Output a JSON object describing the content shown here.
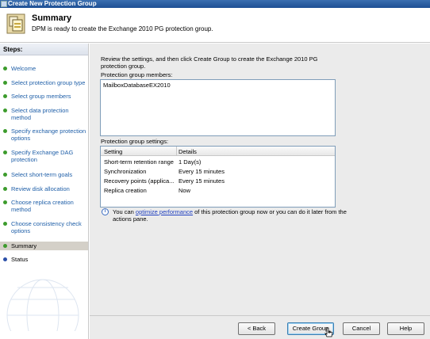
{
  "window": {
    "title": "Create New Protection Group"
  },
  "header": {
    "title": "Summary",
    "subtitle": "DPM is ready to create the Exchange 2010 PG protection group."
  },
  "sidebar": {
    "title": "Steps:",
    "items": [
      {
        "label": "Welcome"
      },
      {
        "label": "Select protection group type"
      },
      {
        "label": "Select group members"
      },
      {
        "label": "Select data protection method"
      },
      {
        "label": "Specify exchange protection options"
      },
      {
        "label": "Specify Exchange DAG protection"
      },
      {
        "label": "Select short-term goals"
      },
      {
        "label": "Review disk allocation"
      },
      {
        "label": "Choose replica creation method"
      },
      {
        "label": "Choose consistency check options"
      },
      {
        "label": "Summary"
      },
      {
        "label": "Status"
      }
    ]
  },
  "main": {
    "intro": "Review the settings, and then click Create Group to create the Exchange 2010 PG protection group.",
    "members_label": "Protection group members:",
    "members": [
      "MailboxDatabaseEX2010"
    ],
    "settings_label": "Protection group settings:",
    "columns": [
      "Setting",
      "Details"
    ],
    "rows": [
      {
        "setting": "Short-term retention range",
        "details": "1 Day(s)"
      },
      {
        "setting": "Synchronization",
        "details": "Every 15 minutes"
      },
      {
        "setting": "Recovery points (applica...",
        "details": "Every 15 minutes"
      },
      {
        "setting": "Replica creation",
        "details": "Now"
      }
    ],
    "info_prefix": "You can ",
    "info_link": "optimize performance",
    "info_suffix": " of this protection group now or you can do it later from the actions pane."
  },
  "buttons": {
    "back": "< Back",
    "create": "Create Group",
    "cancel": "Cancel",
    "help": "Help"
  },
  "colors": {
    "accent": "#1f5fa8",
    "done_dot": "#3c9b2c",
    "pending_dot": "#2b4fa8",
    "current_bg": "#d4d0c8"
  }
}
